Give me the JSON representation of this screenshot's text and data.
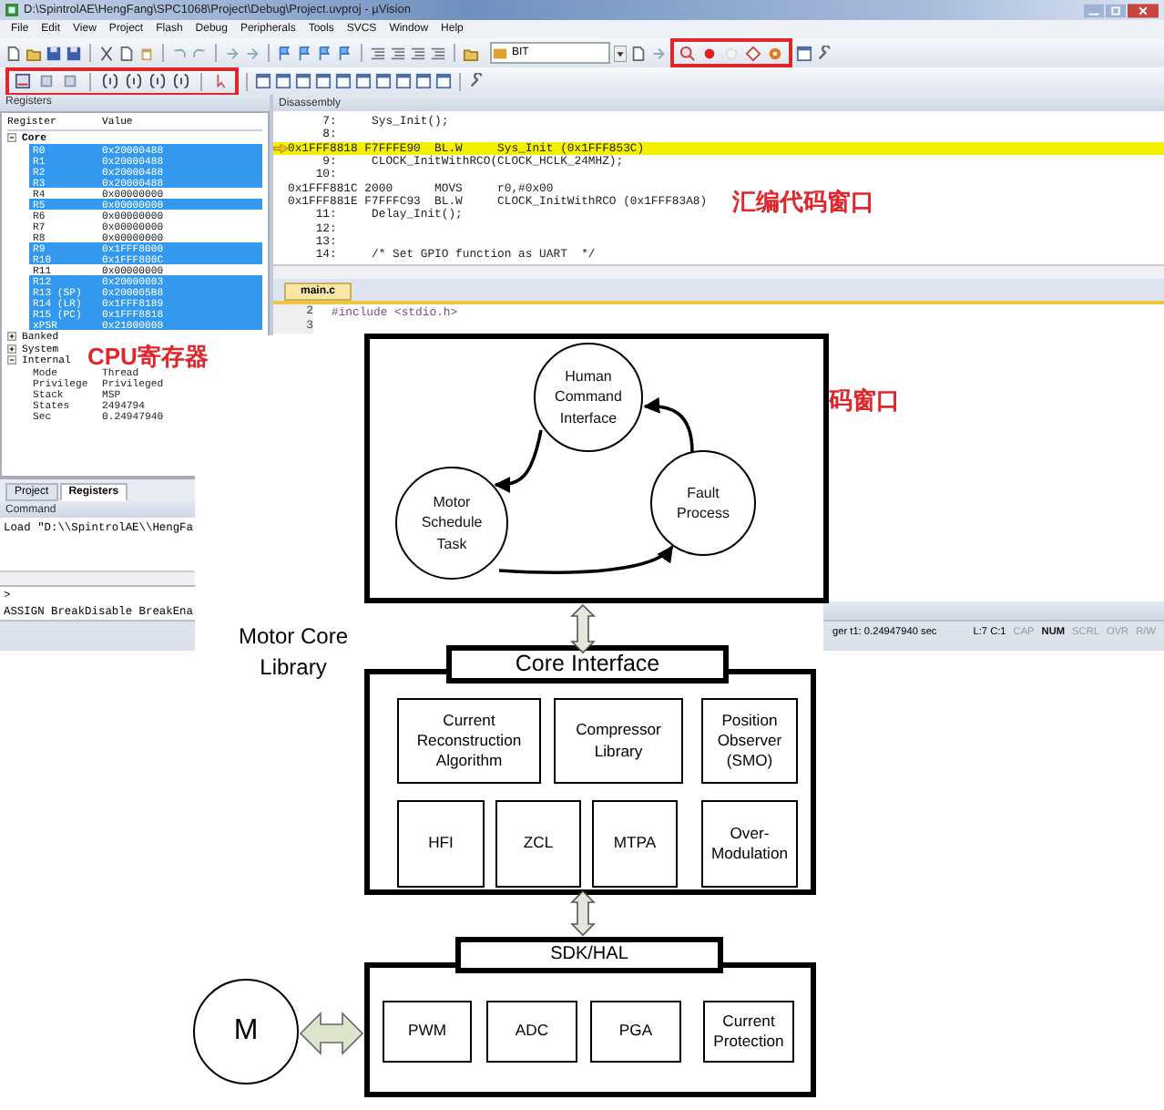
{
  "window": {
    "title": "D:\\SpintrolAE\\HengFang\\SPC1068\\Project\\Debug\\Project.uvproj - µVision"
  },
  "menu": [
    "File",
    "Edit",
    "View",
    "Project",
    "Flash",
    "Debug",
    "Peripherals",
    "Tools",
    "SVCS",
    "Window",
    "Help"
  ],
  "toolbar": {
    "target_field": "BIT"
  },
  "registers_panel": {
    "title": "Registers",
    "columns": [
      "Register",
      "Value"
    ],
    "groups": [
      {
        "name": "Core",
        "expanded": true,
        "children": [
          {
            "name": "R0",
            "value": "0x20000488",
            "selected": true
          },
          {
            "name": "R1",
            "value": "0x20000488",
            "selected": true
          },
          {
            "name": "R2",
            "value": "0x20000488",
            "selected": true
          },
          {
            "name": "R3",
            "value": "0x20000488",
            "selected": true
          },
          {
            "name": "R4",
            "value": "0x00000000",
            "selected": false
          },
          {
            "name": "R5",
            "value": "0x00000000",
            "selected": true
          },
          {
            "name": "R6",
            "value": "0x00000000",
            "selected": false
          },
          {
            "name": "R7",
            "value": "0x00000000",
            "selected": false
          },
          {
            "name": "R8",
            "value": "0x00000000",
            "selected": false
          },
          {
            "name": "R9",
            "value": "0x1FFF8000",
            "selected": true
          },
          {
            "name": "R10",
            "value": "0x1FFF800C",
            "selected": true
          },
          {
            "name": "R11",
            "value": "0x00000000",
            "selected": false
          },
          {
            "name": "R12",
            "value": "0x20000003",
            "selected": true
          },
          {
            "name": "R13 (SP)",
            "value": "0x200005B8",
            "selected": true
          },
          {
            "name": "R14 (LR)",
            "value": "0x1FFF8189",
            "selected": true
          },
          {
            "name": "R15 (PC)",
            "value": "0x1FFF8818",
            "selected": true
          },
          {
            "name": "xPSR",
            "value": "0x21000000",
            "selected": true
          }
        ]
      },
      {
        "name": "Banked",
        "expanded": false
      },
      {
        "name": "System",
        "expanded": false
      },
      {
        "name": "Internal",
        "expanded": true,
        "children": [
          {
            "name": "Mode",
            "value": "Thread"
          },
          {
            "name": "Privilege",
            "value": "Privileged"
          },
          {
            "name": "Stack",
            "value": "MSP"
          },
          {
            "name": "States",
            "value": "2494794"
          },
          {
            "name": "Sec",
            "value": "0.24947940"
          }
        ]
      }
    ]
  },
  "panel_tabs": [
    {
      "label": "Project",
      "selected": false
    },
    {
      "label": "Registers",
      "selected": true
    }
  ],
  "command_panel": {
    "title": "Command",
    "output": "Load \"D:\\\\SpintrolAE\\\\HengFa",
    "prompt": ">",
    "hint": "ASSIGN BreakDisable BreakEna"
  },
  "disassembly": {
    "title": "Disassembly",
    "lines": [
      {
        "text": "     7:     Sys_Init();",
        "current": false
      },
      {
        "text": "     8: ",
        "current": false
      },
      {
        "text": "0x1FFF8818 F7FFFE90  BL.W     Sys_Init (0x1FFF853C)",
        "current": true
      },
      {
        "text": "     9:     CLOCK_InitWithRCO(CLOCK_HCLK_24MHZ);",
        "current": false
      },
      {
        "text": "    10: ",
        "current": false
      },
      {
        "text": "0x1FFF881C 2000      MOVS     r0,#0x00",
        "current": false
      },
      {
        "text": "0x1FFF881E F7FFFC93  BL.W     CLOCK_InitWithRCO (0x1FFF83A8)",
        "current": false
      },
      {
        "text": "    11:     Delay_Init();",
        "current": false
      },
      {
        "text": "    12: ",
        "current": false
      },
      {
        "text": "    13: ",
        "current": false
      },
      {
        "text": "    14:     /* Set GPIO function as UART  */",
        "current": false
      }
    ]
  },
  "editor": {
    "tab": "main.c",
    "lines": [
      {
        "number": "2",
        "code": "#include <stdio.h>"
      },
      {
        "number": "3"
      }
    ]
  },
  "status_bar": {
    "time": "ger t1: 0.24947940 sec",
    "position": "L:7 C:1",
    "indicators": [
      {
        "label": "CAP",
        "on": false
      },
      {
        "label": "NUM",
        "on": true
      },
      {
        "label": "SCRL",
        "on": false
      },
      {
        "label": "OVR",
        "on": false
      },
      {
        "label": "R/W",
        "on": false
      }
    ]
  },
  "annotations": [
    "CPU寄存器",
    "汇编代码窗口",
    "码窗口"
  ],
  "diagram": {
    "tasks": [
      "Human Command Interface",
      "Motor Schedule Task",
      "Fault Process"
    ],
    "library_label": "Motor Core Library",
    "core_interface": {
      "title": "Core Interface",
      "modules": [
        "Current Reconstruction Algorithm",
        "Compressor Library",
        "Position Observer (SMO)",
        "HFI",
        "ZCL",
        "MTPA",
        "Over-Modulation"
      ]
    },
    "sdk_hal": {
      "title": "SDK/HAL",
      "modules": [
        "PWM",
        "ADC",
        "PGA",
        "Current Protection"
      ]
    },
    "motor": "M"
  }
}
